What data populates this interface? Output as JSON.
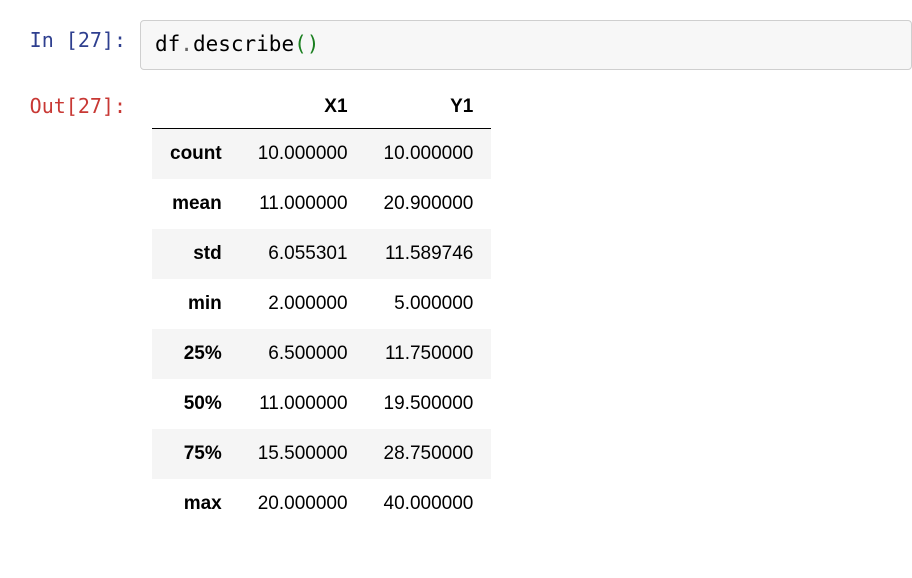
{
  "input": {
    "prompt_label": "In [27]:",
    "code_var": "df",
    "code_dot": ".",
    "code_method": "describe",
    "code_open_paren": "(",
    "code_close_paren": ")"
  },
  "output": {
    "prompt_label": "Out[27]:"
  },
  "dataframe": {
    "columns": [
      "X1",
      "Y1"
    ],
    "index": [
      "count",
      "mean",
      "std",
      "min",
      "25%",
      "50%",
      "75%",
      "max"
    ],
    "rows": [
      {
        "label": "count",
        "X1": "10.000000",
        "Y1": "10.000000"
      },
      {
        "label": "mean",
        "X1": "11.000000",
        "Y1": "20.900000"
      },
      {
        "label": "std",
        "X1": "6.055301",
        "Y1": "11.589746"
      },
      {
        "label": "min",
        "X1": "2.000000",
        "Y1": "5.000000"
      },
      {
        "label": "25%",
        "X1": "6.500000",
        "Y1": "11.750000"
      },
      {
        "label": "50%",
        "X1": "11.000000",
        "Y1": "19.500000"
      },
      {
        "label": "75%",
        "X1": "15.500000",
        "Y1": "28.750000"
      },
      {
        "label": "max",
        "X1": "20.000000",
        "Y1": "40.000000"
      }
    ]
  }
}
